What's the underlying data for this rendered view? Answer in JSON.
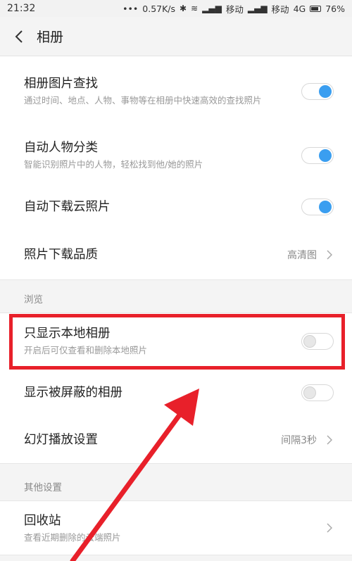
{
  "statusbar": {
    "time": "21:32",
    "dots": "•••",
    "speed": "0.57K/s",
    "carrier1": "移动",
    "carrier2": "移动",
    "network": "4G",
    "battery": "76%"
  },
  "header": {
    "title": "相册"
  },
  "section1": {
    "items": [
      {
        "title": "相册图片查找",
        "subtitle": "通过时间、地点、人物、事物等在相册中快速高效的查找照片",
        "toggle": "on"
      },
      {
        "title": "自动人物分类",
        "subtitle": "智能识别照片中的人物，轻松找到他/她的照片",
        "toggle": "on"
      },
      {
        "title": "自动下载云照片",
        "toggle": "on"
      },
      {
        "title": "照片下载品质",
        "value": "高清图"
      }
    ]
  },
  "section2": {
    "header": "浏览",
    "items": [
      {
        "title": "只显示本地相册",
        "subtitle": "开启后可仅查看和删除本地照片",
        "toggle": "off"
      },
      {
        "title": "显示被屏蔽的相册",
        "toggle": "off"
      },
      {
        "title": "幻灯播放设置",
        "value": "间隔3秒"
      }
    ]
  },
  "section3": {
    "header": "其他设置",
    "items": [
      {
        "title": "回收站",
        "subtitle": "查看近期删除的云端照片"
      }
    ]
  },
  "annotation": {
    "highlight_color": "#e8202a"
  }
}
